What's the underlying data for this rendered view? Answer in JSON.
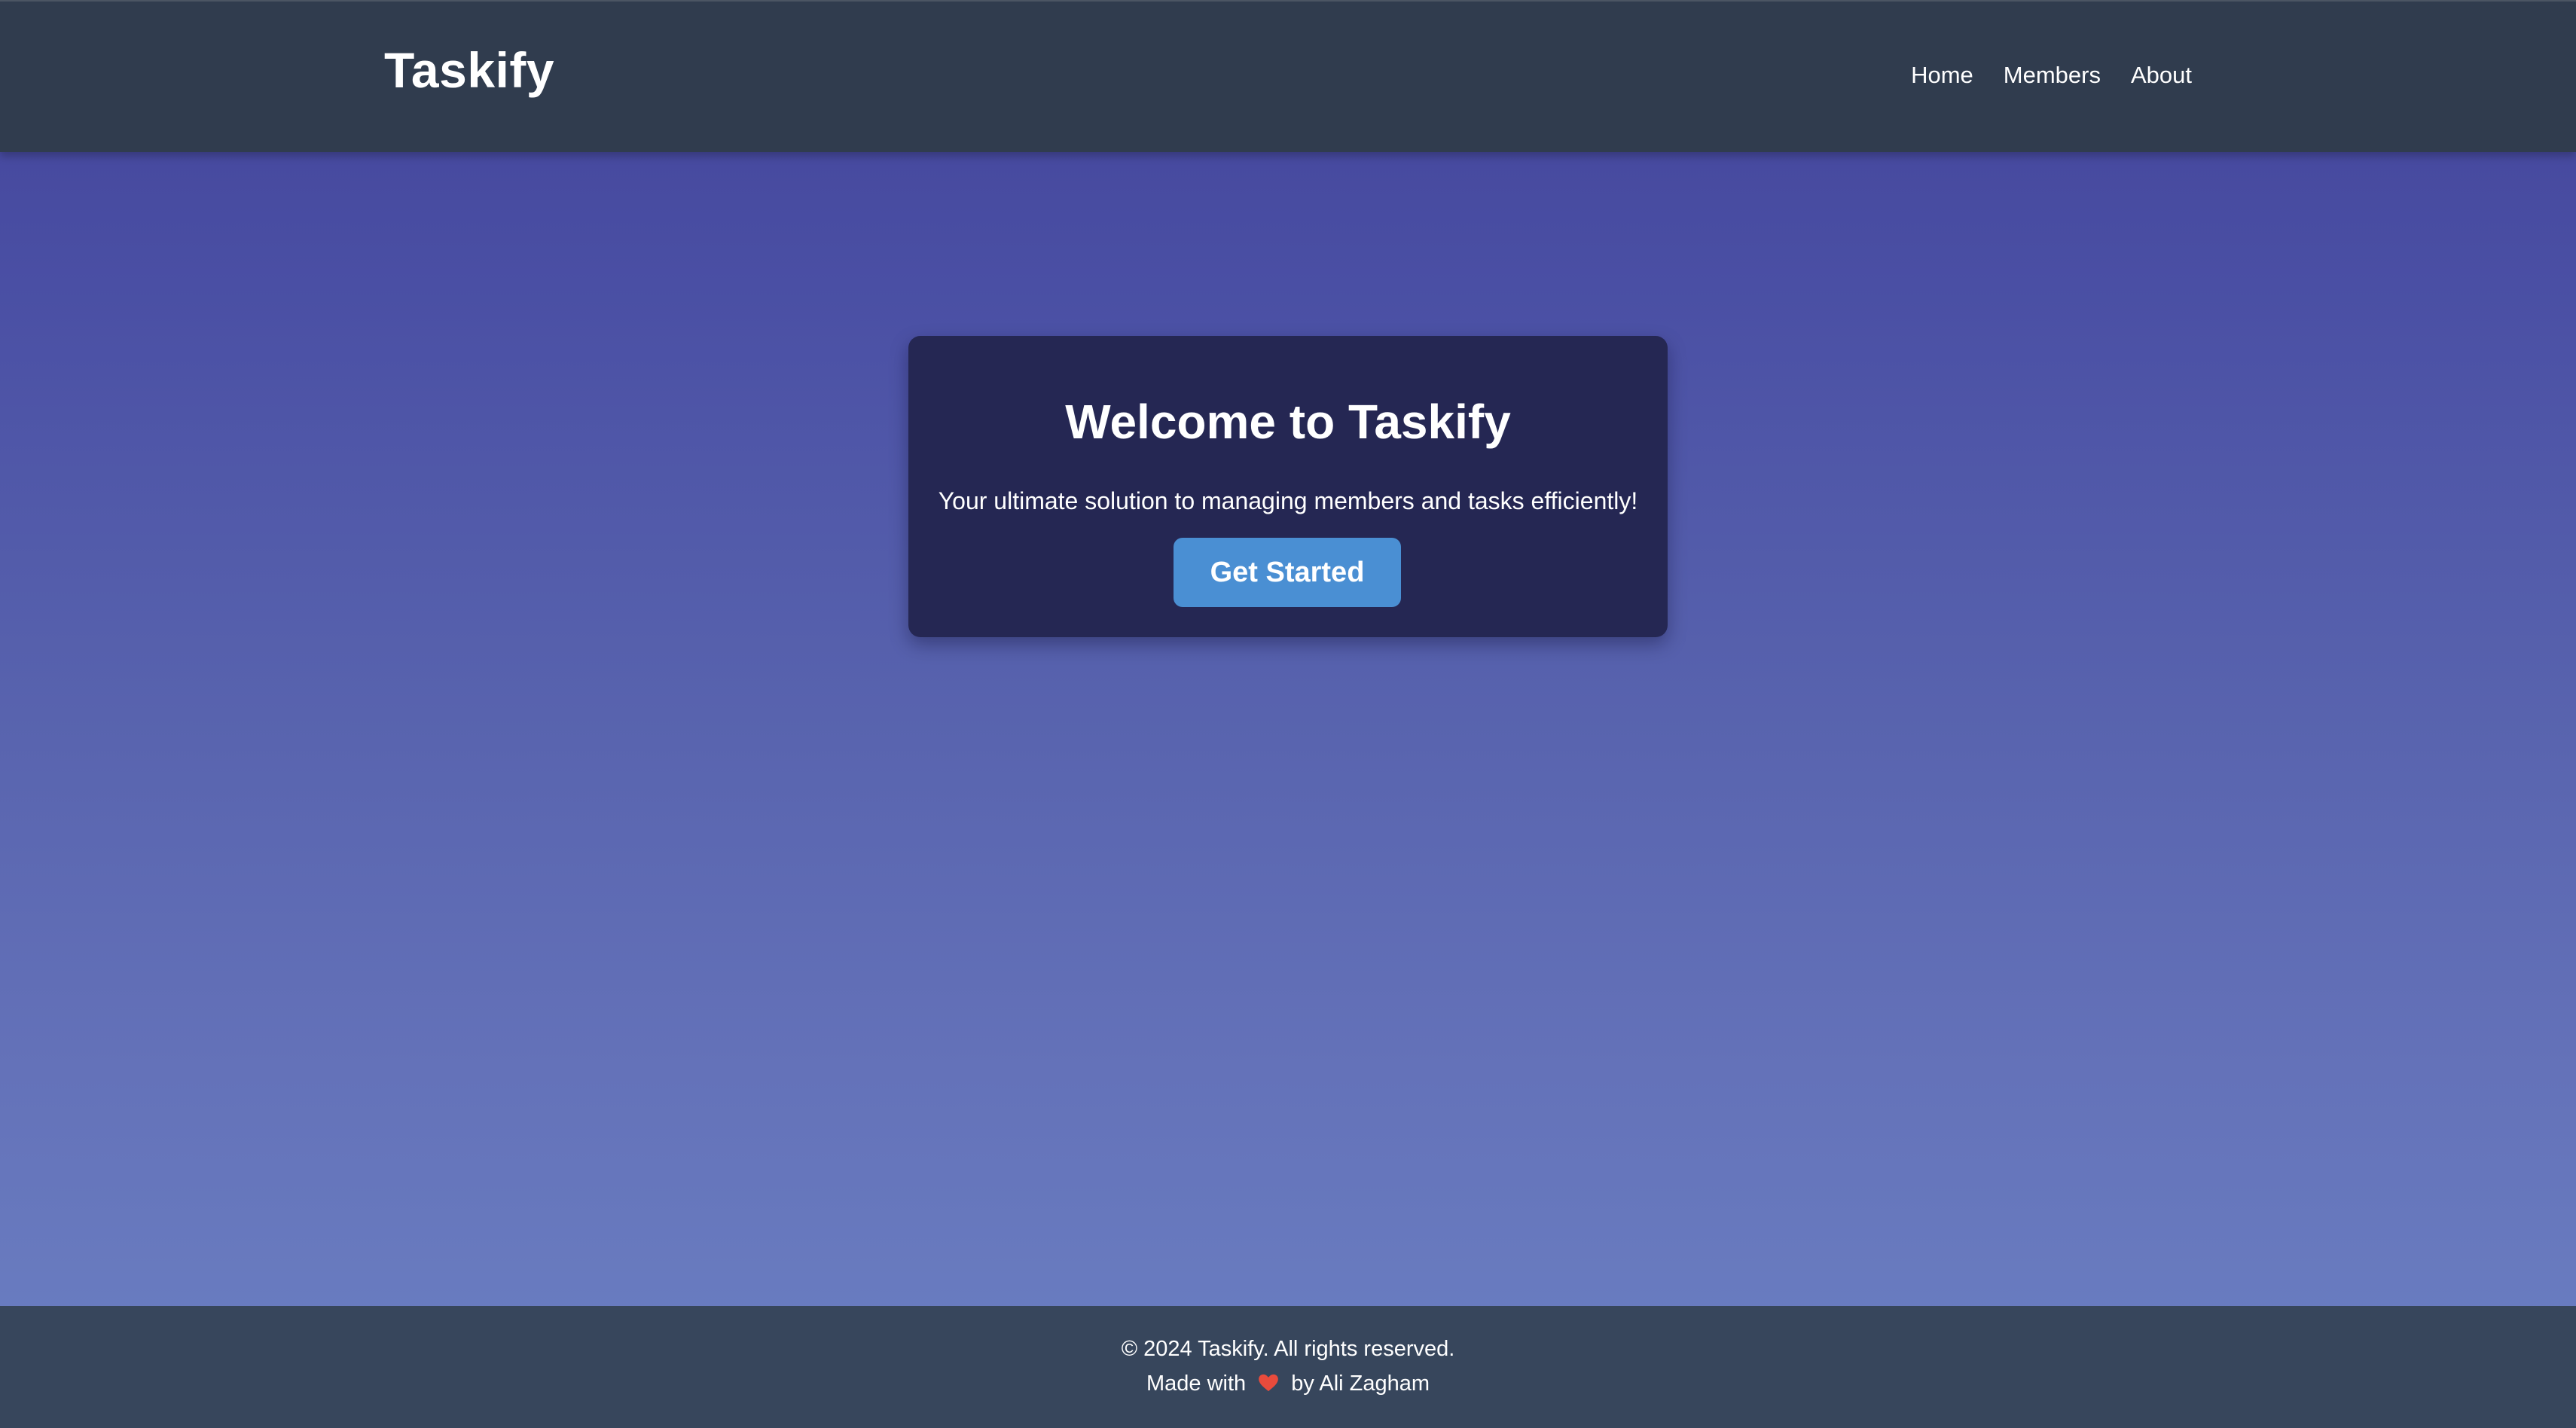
{
  "header": {
    "brand": "Taskify",
    "nav": [
      "Home",
      "Members",
      "About"
    ]
  },
  "hero": {
    "title": "Welcome to Taskify",
    "subtitle": "Your ultimate solution to managing members and tasks efficiently!",
    "cta_label": "Get Started"
  },
  "footer": {
    "copyright": "© 2024 Taskify. All rights reserved.",
    "made_with_prefix": "Made with",
    "made_with_suffix": "by Ali Zagham",
    "heart_icon": "heart-icon"
  },
  "colors": {
    "navbar_bg": "#303c4e",
    "card_bg": "#252753",
    "button_bg": "#4a8fd3",
    "footer_bg": "#37465c",
    "heart": "#e94b3c"
  }
}
